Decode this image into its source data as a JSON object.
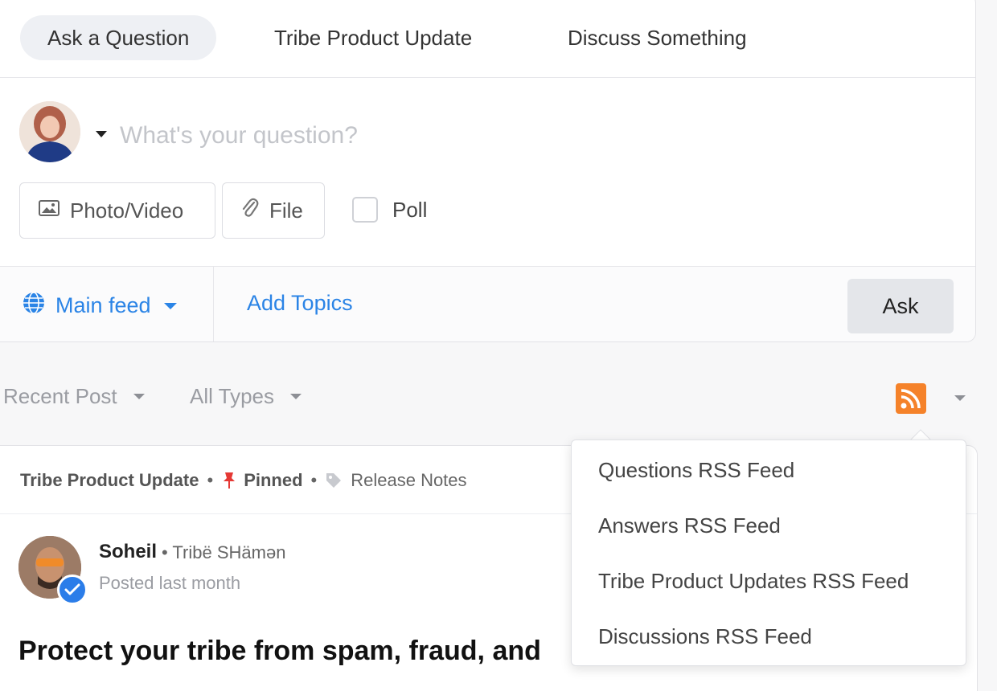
{
  "composer": {
    "tabs": [
      {
        "label": "Ask a Question",
        "active": true
      },
      {
        "label": "Tribe Product Update",
        "active": false
      },
      {
        "label": "Discuss Something",
        "active": false
      }
    ],
    "question_placeholder": "What's your question?",
    "photo_video_label": "Photo/Video",
    "file_label": "File",
    "poll_label": "Poll",
    "feed_label": "Main feed",
    "add_topics_label": "Add Topics",
    "ask_label": "Ask"
  },
  "filters": {
    "sort_label": "Recent Post",
    "type_label": "All Types"
  },
  "rss_menu": {
    "items": [
      "Questions RSS Feed",
      "Answers RSS Feed",
      "Tribe Product Updates RSS Feed",
      "Discussions RSS Feed"
    ]
  },
  "post": {
    "category": "Tribe Product Update",
    "pinned_label": "Pinned",
    "tag": "Release Notes",
    "author_name": "Soheil",
    "author_role": "Tribë SHämən",
    "posted": "Posted last month",
    "title": "Protect your tribe from spam, fraud, and"
  },
  "colors": {
    "accent": "#2b84e6",
    "rss": "#f5822a",
    "pin": "#e53935",
    "verified": "#2b7de9"
  },
  "icons": [
    "globe-icon",
    "image-icon",
    "paperclip-icon",
    "rss-icon",
    "pin-icon",
    "tag-icon",
    "verified-icon"
  ]
}
